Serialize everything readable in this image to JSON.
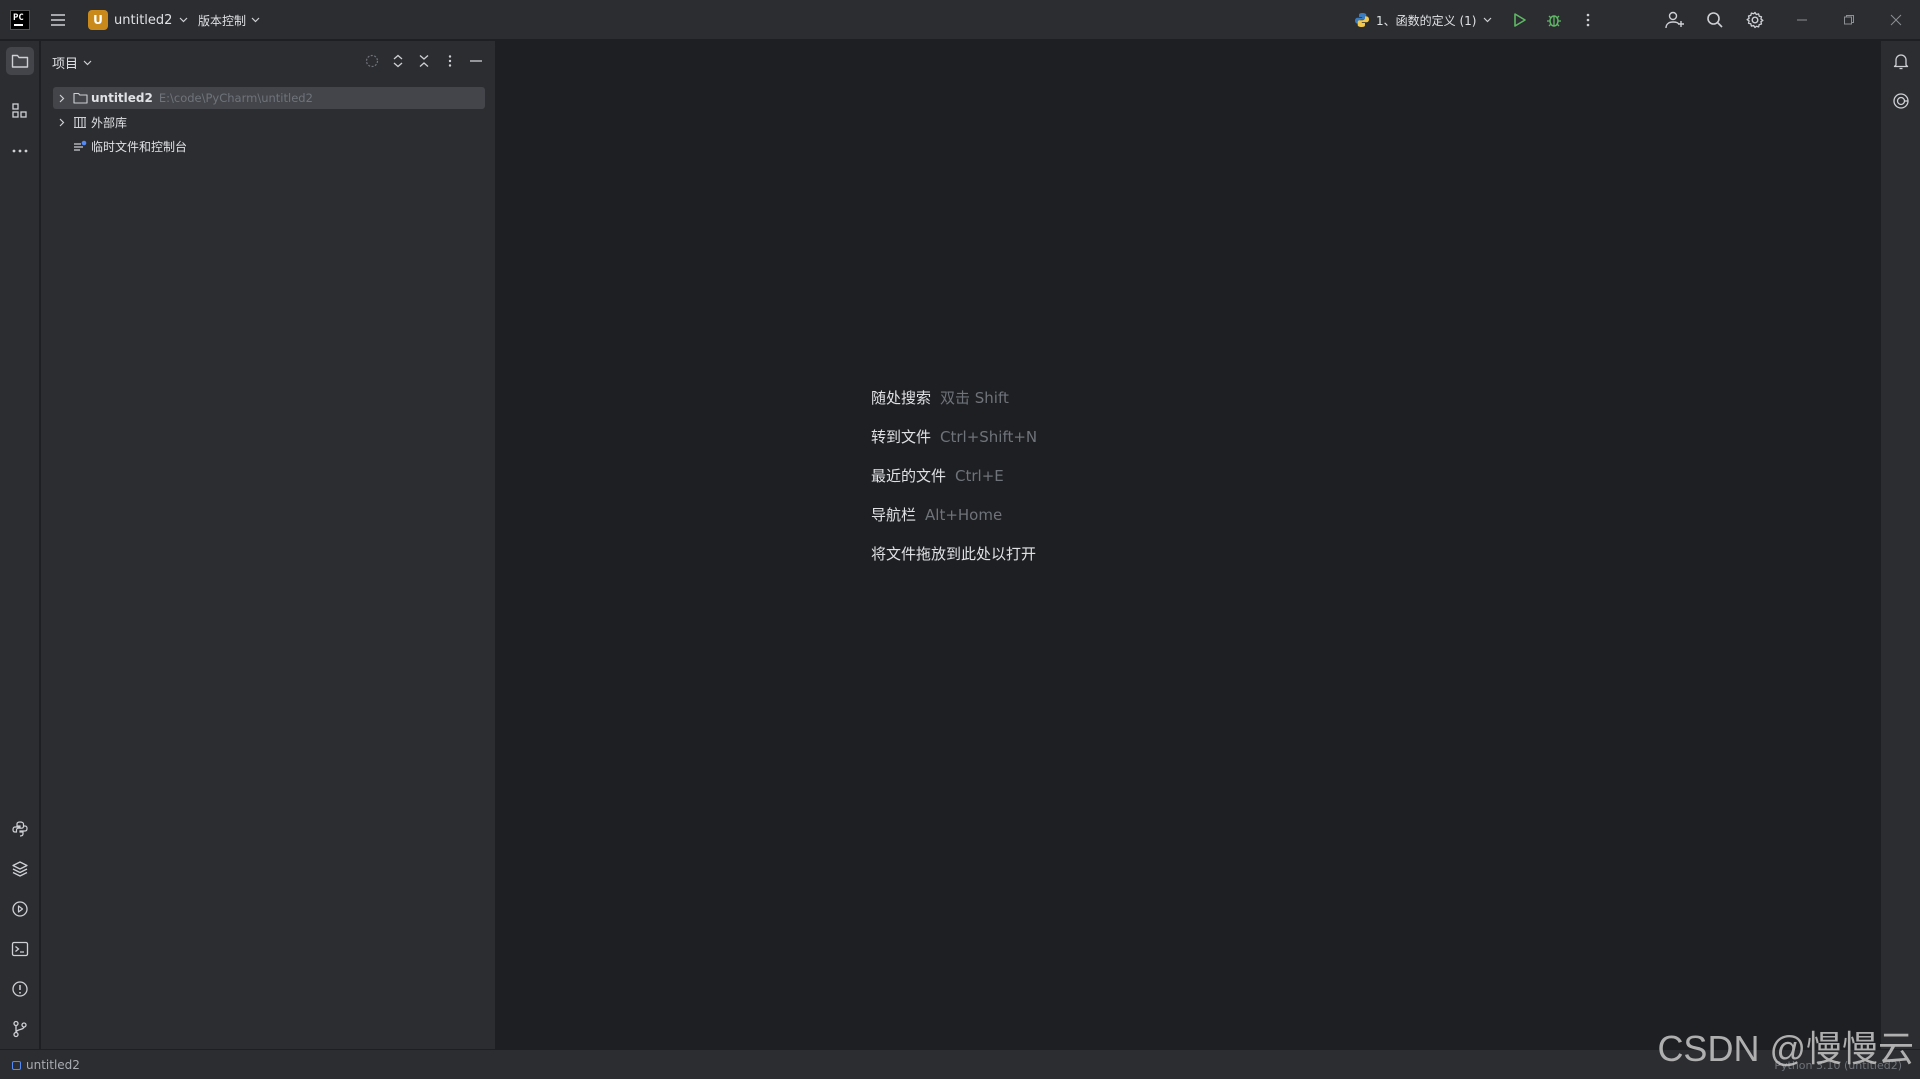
{
  "titlebar": {
    "app_logo": "PC",
    "project_badge": "U",
    "project_name": "untitled2",
    "vcs_label": "版本控制",
    "run_config": "1、函数的定义 (1)"
  },
  "project_panel": {
    "title": "项目",
    "tree": [
      {
        "label": "untitled2",
        "path": "E:\\code\\PyCharm\\untitled2"
      },
      {
        "label": "外部库"
      },
      {
        "label": "临时文件和控制台"
      }
    ]
  },
  "editor": {
    "hints": [
      {
        "action": "随处搜索",
        "shortcut": "双击 Shift"
      },
      {
        "action": "转到文件",
        "shortcut": "Ctrl+Shift+N"
      },
      {
        "action": "最近的文件",
        "shortcut": "Ctrl+E"
      },
      {
        "action": "导航栏",
        "shortcut": "Alt+Home"
      },
      {
        "action": "将文件拖放到此处以打开",
        "shortcut": ""
      }
    ]
  },
  "statusbar": {
    "project": "untitled2",
    "interpreter": "Python 3.10 (untitled2)"
  },
  "watermark": "CSDN @慢慢云",
  "colors": {
    "background": "#1e1f22",
    "panel": "#2b2d30",
    "selection": "#43454a",
    "project_badge": "#c98a1b",
    "run_green": "#5fb865",
    "accent_blue": "#548af7"
  }
}
